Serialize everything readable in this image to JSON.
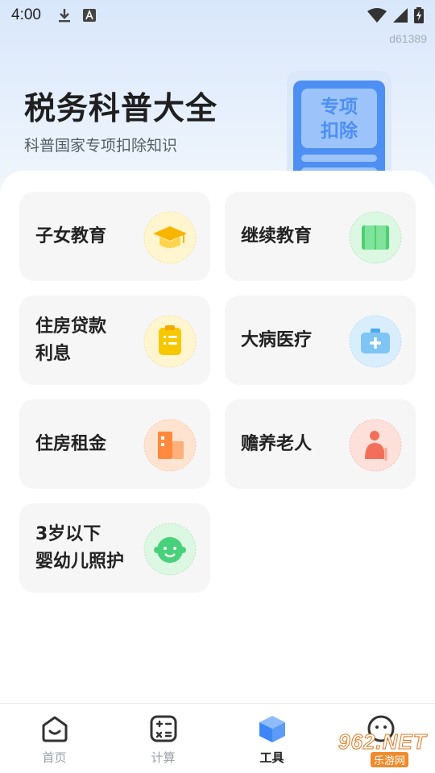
{
  "status_bar": {
    "time": "4:00",
    "device_id": "d61389"
  },
  "hero": {
    "title": "税务科普大全",
    "subtitle": "科普国家专项扣除知识",
    "phone_text_line1": "专项",
    "phone_text_line2": "扣除"
  },
  "cards": [
    {
      "label": "子女教育",
      "icon": "graduation-cap-icon",
      "color": "#f7b500"
    },
    {
      "label": "继续教育",
      "icon": "book-icon",
      "color": "#4fcf72"
    },
    {
      "label": "住房贷款\n利息",
      "icon": "clipboard-icon",
      "color": "#f7c800"
    },
    {
      "label": "大病医疗",
      "icon": "medical-kit-icon",
      "color": "#4aa9ef"
    },
    {
      "label": "住房租金",
      "icon": "building-icon",
      "color": "#ff8a3d"
    },
    {
      "label": "赡养老人",
      "icon": "elderly-person-icon",
      "color": "#f2705a"
    },
    {
      "label": "3岁以下\n婴幼儿照护",
      "icon": "baby-face-icon",
      "color": "#49d07a"
    }
  ],
  "tabs": [
    {
      "label": "首页",
      "icon": "home-icon",
      "active": false
    },
    {
      "label": "计算",
      "icon": "calculator-icon",
      "active": false
    },
    {
      "label": "工具",
      "icon": "cube-icon",
      "active": true
    },
    {
      "label": "",
      "icon": "smiley-icon",
      "active": false
    }
  ],
  "watermark": {
    "main": "962.NET",
    "sub": "乐游网"
  },
  "colors": {
    "accent_blue": "#3d86f5",
    "card_bg": "#f6f6f7"
  }
}
